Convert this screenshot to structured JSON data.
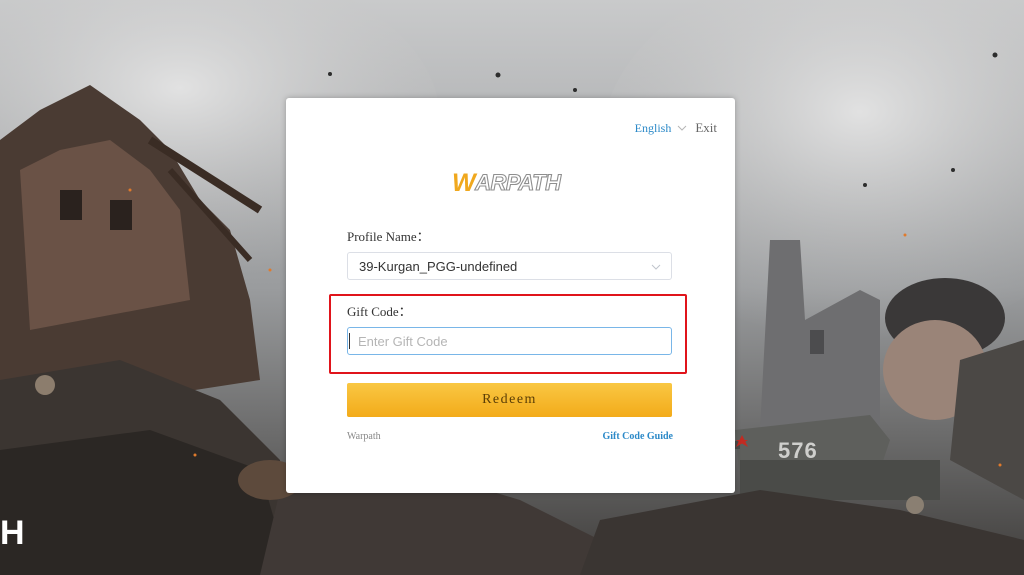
{
  "background": {
    "tank_number": "576",
    "logo_fragment": "H"
  },
  "header": {
    "language": "English",
    "exit": "Exit"
  },
  "logo": {
    "first_letter": "W",
    "rest": "ARPATH"
  },
  "form": {
    "profile_label": "Profile Name：",
    "profile_value": "39-Kurgan_PGG-undefined",
    "gift_code_label": "Gift Code：",
    "gift_code_placeholder": "Enter Gift Code",
    "gift_code_value": "",
    "redeem_label": "Redeem"
  },
  "footer": {
    "brand": "Warpath",
    "guide_link": "Gift Code Guide"
  },
  "colors": {
    "accent_yellow": "#f3ab1a",
    "link_blue": "#2b89c8",
    "highlight_red": "#e0141b"
  }
}
